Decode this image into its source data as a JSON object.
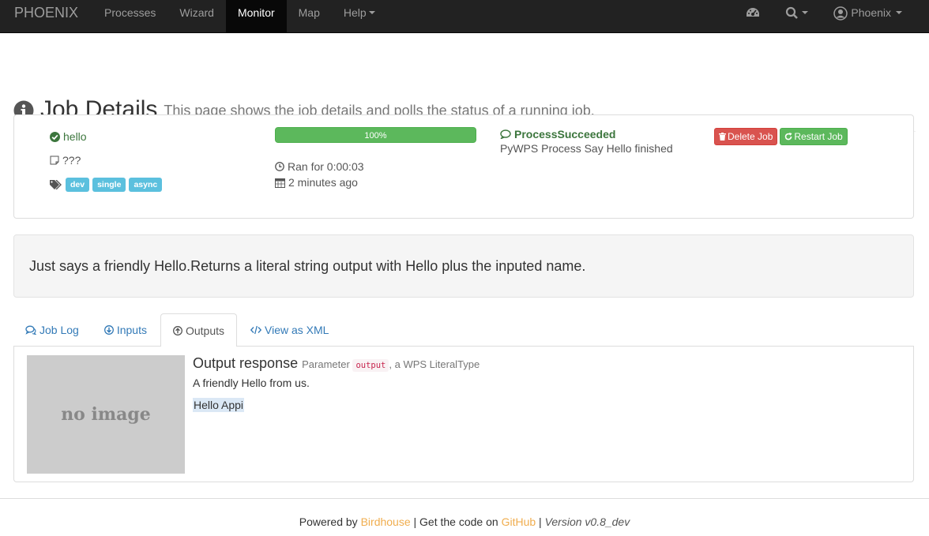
{
  "navbar": {
    "brand": "PHOENIX",
    "items": [
      "Processes",
      "Wizard",
      "Monitor",
      "Map",
      "Help"
    ],
    "active": "Monitor",
    "user": "Phoenix"
  },
  "header": {
    "title": "Job Details",
    "subtitle": "This page shows the job details and polls the status of a running job."
  },
  "job": {
    "name": "hello",
    "caption": "???",
    "tags": [
      "dev",
      "single",
      "async"
    ],
    "progress_label": "100%",
    "progress_value": 100,
    "ran_for": "Ran for 0:00:03",
    "when": "2 minutes ago",
    "status": "ProcessSucceeded",
    "status_message": "PyWPS Process Say Hello finished",
    "delete_label": "Delete Job",
    "restart_label": "Restart Job"
  },
  "description": "Just says a friendly Hello.Returns a literal string output with Hello plus the inputed name.",
  "tabs": [
    "Job Log",
    "Inputs",
    "Outputs",
    "View as XML"
  ],
  "active_tab": "Outputs",
  "output": {
    "image_text": "no image",
    "title": "Output response",
    "param_prefix": "Parameter",
    "param_code": "output",
    "param_suffix": ", a WPS LiteralType",
    "abstract": "A friendly Hello from us.",
    "value": "Hello Appi"
  },
  "footer": {
    "powered": "Powered by",
    "birdhouse": "Birdhouse",
    "code_text": "| Get the code on",
    "github": "GitHub",
    "sep": "|",
    "version": "Version v0.8_dev"
  },
  "colors": {
    "navbar": "#222222",
    "success": "#5cb85c",
    "danger": "#d9534f",
    "info": "#5bc0de",
    "link": "#337ab7",
    "footer_link": "#f0ad4e"
  }
}
